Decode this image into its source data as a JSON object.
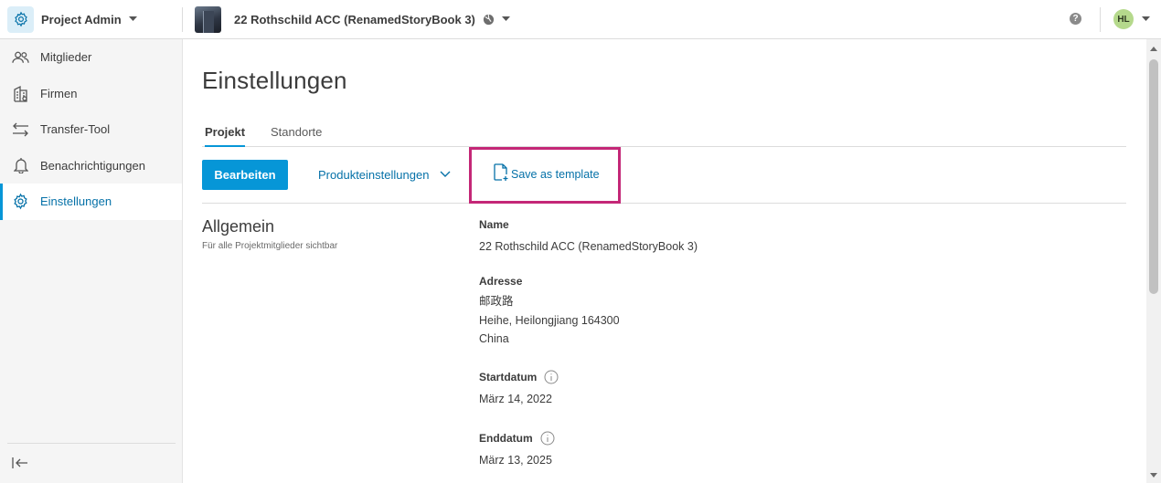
{
  "header": {
    "app_name": "Project Admin",
    "project_name": "22 Rothschild ACC (RenamedStoryBook 3)",
    "help_label": "?",
    "user_initials": "HL"
  },
  "sidebar": {
    "items": [
      {
        "label": "Mitglieder",
        "icon": "members-icon"
      },
      {
        "label": "Firmen",
        "icon": "companies-icon"
      },
      {
        "label": "Transfer-Tool",
        "icon": "transfer-icon"
      },
      {
        "label": "Benachrichtigungen",
        "icon": "bell-icon"
      },
      {
        "label": "Einstellungen",
        "icon": "gear-icon",
        "active": true
      }
    ]
  },
  "main": {
    "title": "Einstellungen",
    "tabs": [
      {
        "label": "Projekt",
        "active": true
      },
      {
        "label": "Standorte",
        "active": false
      }
    ],
    "toolbar": {
      "edit_label": "Bearbeiten",
      "product_settings_label": "Produkteinstellungen",
      "save_template_label": "Save as template"
    },
    "section": {
      "title": "Allgemein",
      "subtitle": "Für alle Projektmitglieder sichtbar"
    },
    "fields": {
      "name": {
        "label": "Name",
        "value": "22 Rothschild ACC (RenamedStoryBook 3)"
      },
      "address": {
        "label": "Adresse",
        "line1": "邮政路",
        "line2": "Heihe, Heilongjiang 164300",
        "line3": "China"
      },
      "start_date": {
        "label": "Startdatum",
        "value": "März 14, 2022"
      },
      "end_date": {
        "label": "Enddatum",
        "value": "März 13, 2025"
      }
    }
  },
  "colors": {
    "accent": "#0696d7",
    "link": "#0571a8",
    "highlight": "#c42777",
    "avatar": "#b5d98c"
  }
}
